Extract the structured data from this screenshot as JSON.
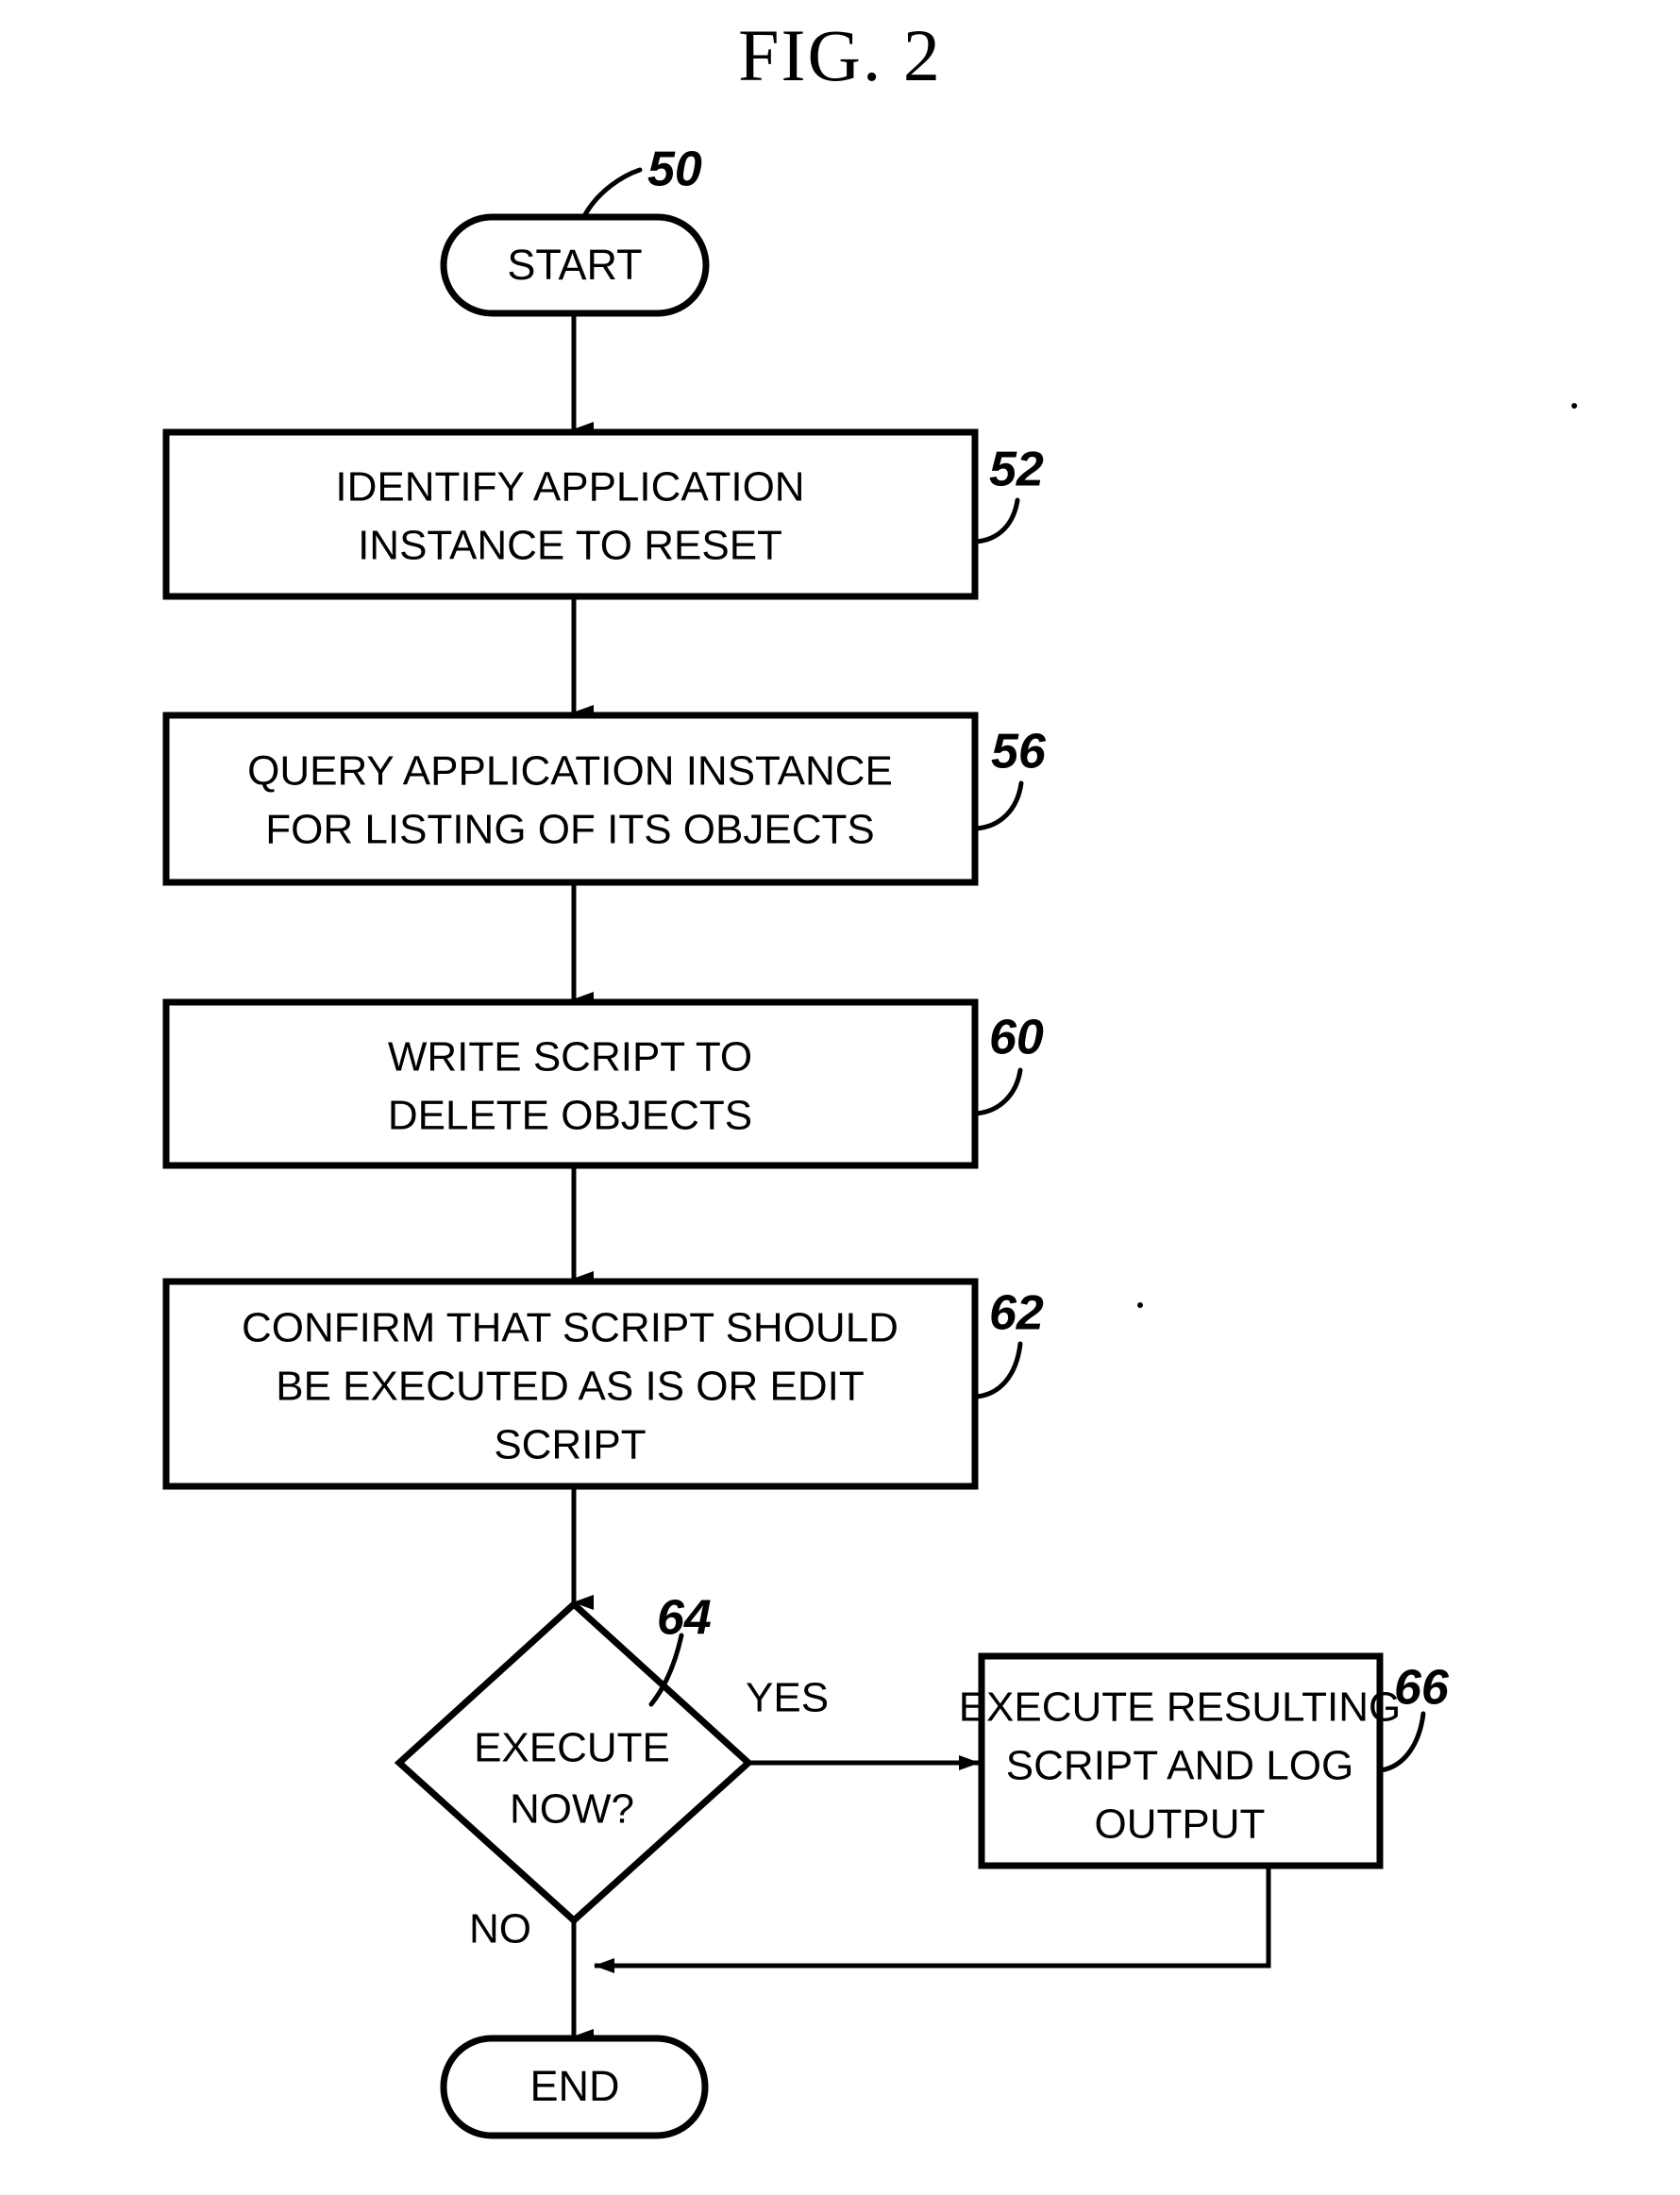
{
  "figure": {
    "title": "FIG. 2",
    "type": "flowchart",
    "reference_numeral_of_method": "50"
  },
  "nodes": {
    "start": {
      "id": "50",
      "shape": "terminator",
      "label": "START",
      "ref": "50"
    },
    "identify": {
      "id": "52",
      "shape": "process",
      "line1": "IDENTIFY APPLICATION",
      "line2": "INSTANCE TO RESET",
      "ref": "52"
    },
    "query": {
      "id": "56",
      "shape": "process",
      "line1": "QUERY APPLICATION INSTANCE",
      "line2": "FOR LISTING OF ITS OBJECTS",
      "ref": "56"
    },
    "write": {
      "id": "60",
      "shape": "process",
      "line1": "WRITE SCRIPT TO",
      "line2": "DELETE OBJECTS",
      "ref": "60"
    },
    "confirm": {
      "id": "62",
      "shape": "process",
      "line1": "CONFIRM THAT SCRIPT SHOULD",
      "line2": "BE EXECUTED AS IS OR EDIT",
      "line3": "SCRIPT",
      "ref": "62"
    },
    "decision": {
      "id": "64",
      "shape": "decision",
      "line1": "EXECUTE",
      "line2": "NOW?",
      "ref": "64"
    },
    "execute": {
      "id": "66",
      "shape": "process",
      "line1": "EXECUTE RESULTING",
      "line2": "SCRIPT AND LOG",
      "line3": "OUTPUT",
      "ref": "66"
    },
    "end": {
      "id": "end",
      "shape": "terminator",
      "label": "END"
    }
  },
  "branch_labels": {
    "yes": "YES",
    "no": "NO"
  },
  "colors": {
    "ink": "#000000",
    "paper": "#ffffff"
  }
}
